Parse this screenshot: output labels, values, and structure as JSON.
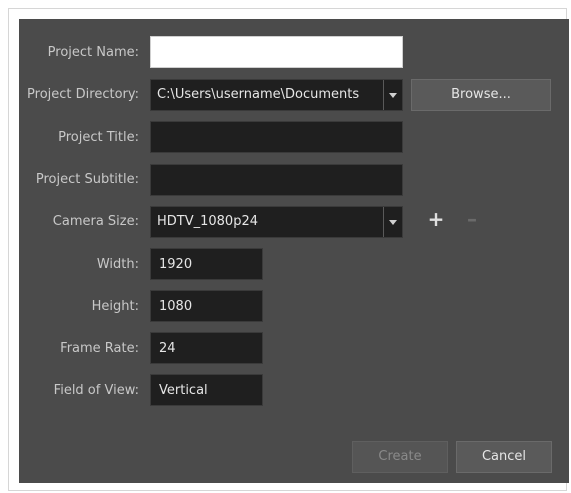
{
  "form": {
    "project_name_label": "Project Name:",
    "project_name_value": "",
    "project_directory_label": "Project Directory:",
    "project_directory_value": "C:\\Users\\username\\Documents",
    "browse_label": "Browse...",
    "project_title_label": "Project Title:",
    "project_title_value": "",
    "project_subtitle_label": "Project Subtitle:",
    "project_subtitle_value": "",
    "camera_size_label": "Camera Size:",
    "camera_size_value": "HDTV_1080p24",
    "add_symbol": "+",
    "remove_symbol": "–",
    "width_label": "Width:",
    "width_value": "1920",
    "height_label": "Height:",
    "height_value": "1080",
    "frame_rate_label": "Frame Rate:",
    "frame_rate_value": "24",
    "field_of_view_label": "Field of View:",
    "field_of_view_value": "Vertical"
  },
  "footer": {
    "create_label": "Create",
    "cancel_label": "Cancel"
  }
}
